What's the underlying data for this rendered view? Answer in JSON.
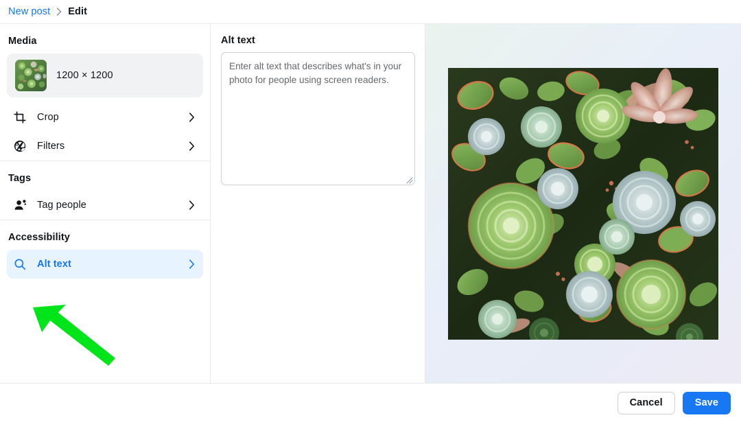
{
  "breadcrumb": {
    "parent": "New post",
    "separator": "›",
    "current": "Edit"
  },
  "sidebar": {
    "sections": [
      {
        "title": "Media",
        "media_card": {
          "dimensions": "1200 × 1200",
          "thumbnail_icon": "succulent-photo-thumbnail"
        },
        "items": [
          {
            "label": "Crop",
            "icon": "crop-icon",
            "chevron": "chevron-right-icon",
            "selected": false
          },
          {
            "label": "Filters",
            "icon": "filters-aperture-icon",
            "chevron": "chevron-right-icon",
            "selected": false
          }
        ]
      },
      {
        "title": "Tags",
        "items": [
          {
            "label": "Tag people",
            "icon": "tag-people-icon",
            "chevron": "chevron-right-icon",
            "selected": false
          }
        ]
      },
      {
        "title": "Accessibility",
        "items": [
          {
            "label": "Alt text",
            "icon": "search-icon",
            "chevron": "chevron-right-icon",
            "selected": true
          }
        ]
      }
    ]
  },
  "editor": {
    "title": "Alt text",
    "alt_text_value": "",
    "alt_text_placeholder": "Enter alt text that describes what's in your photo for people using screen readers.",
    "resize_handle": "resize-grip-icon"
  },
  "preview": {
    "image_alt": "Dense garden of green, blue-grey and pink-tipped succulent rosettes"
  },
  "footer": {
    "cancel_label": "Cancel",
    "save_label": "Save"
  },
  "annotation": {
    "type": "arrow",
    "color": "#00e519",
    "points_to": "Alt text"
  },
  "colors": {
    "accent_blue": "#1877f2",
    "selected_row_bg": "#e7f3ff",
    "text_primary": "#111418",
    "text_muted": "#65686c",
    "border": "#ced0d4",
    "divider": "#e9eaec",
    "card_bg": "#f1f2f3",
    "annotation_green": "#00e519"
  }
}
